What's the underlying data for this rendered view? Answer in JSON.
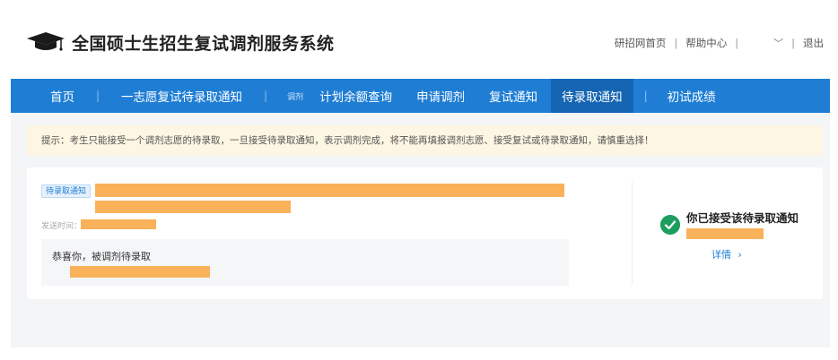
{
  "header": {
    "title": "全国硕士生招生复试调剂服务系统",
    "links": {
      "home": "研招网首页",
      "help": "帮助中心",
      "logout": "退出"
    },
    "separator": "|",
    "user_chevron": "﹀"
  },
  "nav": {
    "separator": "|",
    "items": [
      {
        "label": "首页"
      },
      {
        "label": "一志愿复试待录取通知"
      },
      {
        "label": "调剂",
        "small": true
      },
      {
        "label": "计划余额查询"
      },
      {
        "label": "申请调剂"
      },
      {
        "label": "复试通知"
      },
      {
        "label": "待录取通知",
        "active": true
      },
      {
        "label": "初试成绩"
      }
    ]
  },
  "notice": {
    "text": "提示：考生只能接受一个调剂志愿的待录取，一旦接受待录取通知，表示调剂完成，将不能再填报调剂志愿、接受复试或待录取通知，请慎重选择！"
  },
  "card": {
    "tag": "待录取通知",
    "send_time_label": "发送时间：",
    "message": "恭喜你，被调剂待录取",
    "status_title": "你已接受该待录取通知",
    "detail_label": "详情",
    "detail_arrow": "›"
  },
  "colors": {
    "nav_bg": "#1f7ed4",
    "nav_active": "#1565b3",
    "notice_bg": "#fdf6e3",
    "redaction": "#f9b25a",
    "success": "#1d9e5e"
  }
}
